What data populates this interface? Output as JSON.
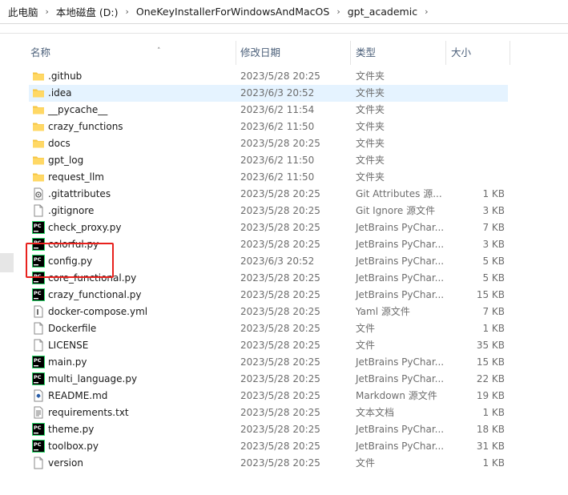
{
  "breadcrumb": [
    "此电脑",
    "本地磁盘 (D:)",
    "OneKeyInstallerForWindowsAndMacOS",
    "gpt_academic"
  ],
  "columns": {
    "name": "名称",
    "date": "修改日期",
    "type": "类型",
    "size": "大小"
  },
  "highlight_color": "#e8211d",
  "files": [
    {
      "name": ".github",
      "date": "2023/5/28 20:25",
      "type": "文件夹",
      "size": "",
      "icon": "folder-icon"
    },
    {
      "name": ".idea",
      "date": "2023/6/3 20:52",
      "type": "文件夹",
      "size": "",
      "icon": "folder-icon",
      "selected": true
    },
    {
      "name": "__pycache__",
      "date": "2023/6/2 11:54",
      "type": "文件夹",
      "size": "",
      "icon": "folder-icon"
    },
    {
      "name": "crazy_functions",
      "date": "2023/6/2 11:50",
      "type": "文件夹",
      "size": "",
      "icon": "folder-icon"
    },
    {
      "name": "docs",
      "date": "2023/5/28 20:25",
      "type": "文件夹",
      "size": "",
      "icon": "folder-icon"
    },
    {
      "name": "gpt_log",
      "date": "2023/6/2 11:50",
      "type": "文件夹",
      "size": "",
      "icon": "folder-icon"
    },
    {
      "name": "request_llm",
      "date": "2023/6/2 11:50",
      "type": "文件夹",
      "size": "",
      "icon": "folder-icon"
    },
    {
      "name": ".gitattributes",
      "date": "2023/5/28 20:25",
      "type": "Git Attributes 源...",
      "size": "1 KB",
      "icon": "gear-file-icon"
    },
    {
      "name": ".gitignore",
      "date": "2023/5/28 20:25",
      "type": "Git Ignore 源文件",
      "size": "3 KB",
      "icon": "blank-file-icon"
    },
    {
      "name": "check_proxy.py",
      "date": "2023/5/28 20:25",
      "type": "JetBrains PyChar...",
      "size": "7 KB",
      "icon": "pycharm-icon"
    },
    {
      "name": "colorful.py",
      "date": "2023/5/28 20:25",
      "type": "JetBrains PyChar...",
      "size": "3 KB",
      "icon": "pycharm-icon"
    },
    {
      "name": "config.py",
      "date": "2023/6/3 20:52",
      "type": "JetBrains PyChar...",
      "size": "5 KB",
      "icon": "pycharm-icon"
    },
    {
      "name": "core_functional.py",
      "date": "2023/5/28 20:25",
      "type": "JetBrains PyChar...",
      "size": "5 KB",
      "icon": "pycharm-icon"
    },
    {
      "name": "crazy_functional.py",
      "date": "2023/5/28 20:25",
      "type": "JetBrains PyChar...",
      "size": "15 KB",
      "icon": "pycharm-icon"
    },
    {
      "name": "docker-compose.yml",
      "date": "2023/5/28 20:25",
      "type": "Yaml 源文件",
      "size": "7 KB",
      "icon": "yaml-file-icon"
    },
    {
      "name": "Dockerfile",
      "date": "2023/5/28 20:25",
      "type": "文件",
      "size": "1 KB",
      "icon": "blank-file-icon"
    },
    {
      "name": "LICENSE",
      "date": "2023/5/28 20:25",
      "type": "文件",
      "size": "35 KB",
      "icon": "blank-file-icon"
    },
    {
      "name": "main.py",
      "date": "2023/5/28 20:25",
      "type": "JetBrains PyChar...",
      "size": "15 KB",
      "icon": "pycharm-icon"
    },
    {
      "name": "multi_language.py",
      "date": "2023/5/28 20:25",
      "type": "JetBrains PyChar...",
      "size": "22 KB",
      "icon": "pycharm-icon"
    },
    {
      "name": "README.md",
      "date": "2023/5/28 20:25",
      "type": "Markdown 源文件",
      "size": "19 KB",
      "icon": "markdown-file-icon"
    },
    {
      "name": "requirements.txt",
      "date": "2023/5/28 20:25",
      "type": "文本文档",
      "size": "1 KB",
      "icon": "text-file-icon"
    },
    {
      "name": "theme.py",
      "date": "2023/5/28 20:25",
      "type": "JetBrains PyChar...",
      "size": "18 KB",
      "icon": "pycharm-icon"
    },
    {
      "name": "toolbox.py",
      "date": "2023/5/28 20:25",
      "type": "JetBrains PyChar...",
      "size": "31 KB",
      "icon": "pycharm-icon"
    },
    {
      "name": "version",
      "date": "2023/5/28 20:25",
      "type": "文件",
      "size": "1 KB",
      "icon": "blank-file-icon"
    }
  ]
}
